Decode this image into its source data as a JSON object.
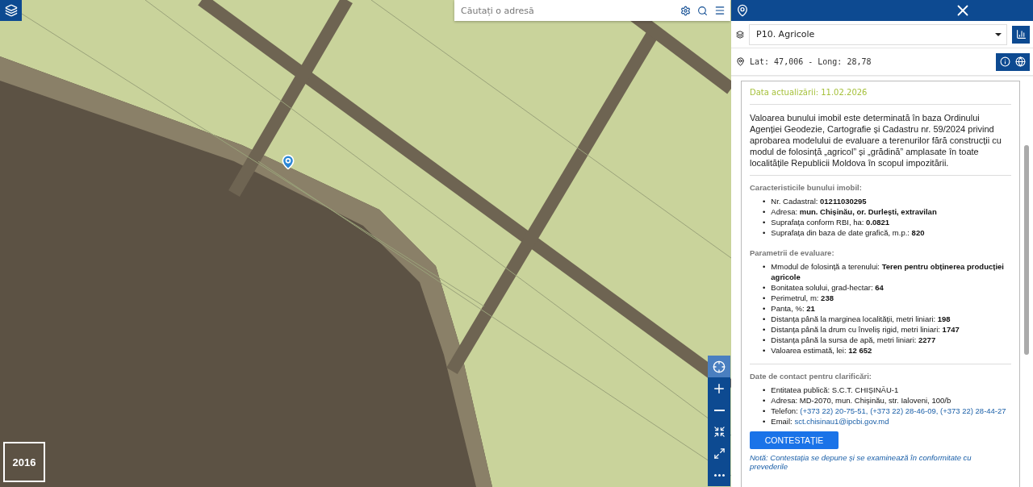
{
  "map": {
    "search": {
      "placeholder": "Căutați o adresă"
    },
    "year": "2016"
  },
  "panel": {
    "layer_select": {
      "value": "P10. Agricole"
    },
    "coordinates": "Lat: 47,006 - Long: 28,78",
    "update_date": "Data actualizării: 11.02.2026",
    "description": "Valoarea bunului imobil este determinată în baza Ordinului Agenției Geodezie, Cartografie și Cadastru nr. 59/2024 privind aprobarea modelului de evaluare a terenurilor fără construcții cu modul de folosință „agricol” și „grădină” amplasate în toate localitățile Republicii Moldova în scopul impozitării.",
    "sections": [
      {
        "title": "Caracteristicile bunului imobil:",
        "items": [
          {
            "bullet": "•",
            "label": "Nr. Cadastral: ",
            "value": "01211030295",
            "kind": "bold"
          },
          {
            "bullet": "•",
            "label": "Adresa: ",
            "value": "mun. Chișinău, or. Durlești, extravilan",
            "kind": "bold"
          },
          {
            "bullet": "•",
            "label": "Suprafața conform RBI, ha: ",
            "value": "0.0821",
            "kind": "bold"
          },
          {
            "bullet": "•",
            "label": "Suprafața din baza de date grafică, m.p.: ",
            "value": "820",
            "kind": "bold"
          }
        ]
      },
      {
        "title": "Parametrii de evaluare:",
        "items": [
          {
            "bullet": "•",
            "label": "Mmodul de folosință a terenului: ",
            "value": "Teren pentru obținerea producției agricole",
            "kind": "bold"
          },
          {
            "bullet": "•",
            "label": "Bonitatea solului, grad-hectar: ",
            "value": "64",
            "kind": "bold"
          },
          {
            "bullet": "•",
            "label": "Perimetrul, m: ",
            "value": "238",
            "kind": "bold"
          },
          {
            "bullet": "•",
            "label": "Panta, %: ",
            "value": "21",
            "kind": "bold"
          },
          {
            "bullet": "•",
            "label": "Distanța până la marginea localității, metri liniari: ",
            "value": "198",
            "kind": "bold"
          },
          {
            "bullet": "•",
            "label": "Distanța până la drum cu înveliș rigid, metri liniari: ",
            "value": "1747",
            "kind": "bold"
          },
          {
            "bullet": "•",
            "label": "Distanța până la sursa de apă, metri liniari: ",
            "value": "2277",
            "kind": "bold"
          },
          {
            "bullet": "•",
            "label": "Valoarea estimată, lei: ",
            "value": "12 652",
            "kind": "bold"
          }
        ]
      },
      {
        "title": "Date de contact pentru clarificări:",
        "items": [
          {
            "bullet": "•",
            "label": "Entitatea publică: ",
            "value": "S.C.T. CHIȘINĂU-1",
            "kind": "plain"
          },
          {
            "bullet": "•",
            "label": "Adresa: ",
            "value": "MD-2070, mun. Chișinău, str. Ialoveni, 100/b",
            "kind": "plain"
          },
          {
            "bullet": "•",
            "label": "Telefon: ",
            "value": "(+373 22) 20-75-51, (+373 22) 28-46-09, (+373 22) 28-44-27",
            "kind": "link"
          },
          {
            "bullet": "•",
            "label": "Email: ",
            "value": "sct.chisinau1@ipcbi.gov.md",
            "kind": "link"
          }
        ]
      }
    ],
    "button": "CONTESTAȚIE",
    "note": "Notă: Contestația se depune și se examinează în conformitate cu prevederile"
  }
}
